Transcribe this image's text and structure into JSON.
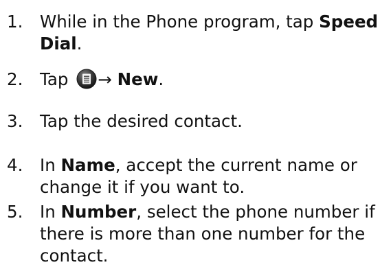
{
  "steps": [
    {
      "number": "1.",
      "lines": [
        {
          "pre": "While in the Phone program, tap ",
          "bold": "Speed"
        },
        {
          "bold": "Dial",
          "post": "."
        }
      ]
    },
    {
      "number": "2.",
      "pre": "Tap ",
      "icon": "menu-icon",
      "arrow": "→",
      "bold": "New",
      "post": "."
    },
    {
      "number": "3.",
      "text": "Tap the desired contact."
    },
    {
      "number": "4.",
      "lines": [
        {
          "pre": "In ",
          "bold": "Name",
          "post": ", accept the current name or"
        },
        {
          "text": "change it if you want to."
        }
      ]
    },
    {
      "number": "5.",
      "lines": [
        {
          "pre": "In ",
          "bold": "Number",
          "post": ", select the phone number if"
        },
        {
          "text": "there is more than one number for the"
        },
        {
          "text": "contact."
        }
      ]
    }
  ]
}
